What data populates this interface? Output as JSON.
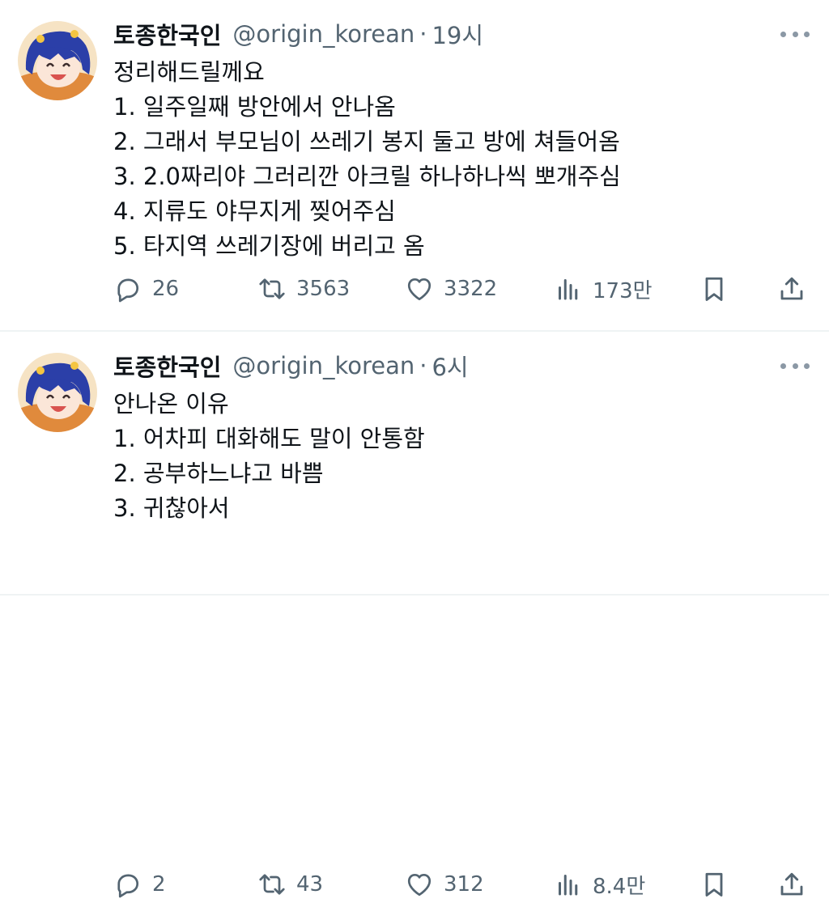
{
  "tweets": [
    {
      "name": "토종한국인",
      "handle": "@origin_korean",
      "separator": "·",
      "time": "19시",
      "lines": [
        "정리해드릴께요",
        "1. 일주일째 방안에서 안나옴",
        "2. 그래서 부모님이 쓰레기 봉지 둘고 방에 쳐들어옴",
        "3. 2.0짜리야 그러리깐 아크릴 하나하나씩 뽀개주심",
        "4. 지류도 야무지게 찢어주심",
        "5. 타지역 쓰레기장에 버리고 옴"
      ],
      "replies": "26",
      "retweets": "3563",
      "likes": "3322",
      "views": "173만"
    },
    {
      "name": "토종한국인",
      "handle": "@origin_korean",
      "separator": "·",
      "time": "6시",
      "lines": [
        "안나온 이유",
        "1. 어차피 대화해도 말이 안통함",
        "2. 공부하느냐고 바쁨",
        "3. 귀찮아서"
      ],
      "replies": "2",
      "retweets": "43",
      "likes": "312",
      "views": "8.4만"
    }
  ],
  "icons": {
    "reply": "comment-bubble-icon",
    "retweet": "retweet-arrows-icon",
    "like": "heart-icon",
    "views": "bar-chart-icon",
    "bookmark": "bookmark-icon",
    "share": "share-upload-icon",
    "more": "more-dots-icon"
  },
  "colors": {
    "text": "#0f1419",
    "secondary": "#536471",
    "divider": "#eff3f4",
    "avatar_hair": "#2b3fa8",
    "avatar_bg": "#f6e3c4"
  }
}
